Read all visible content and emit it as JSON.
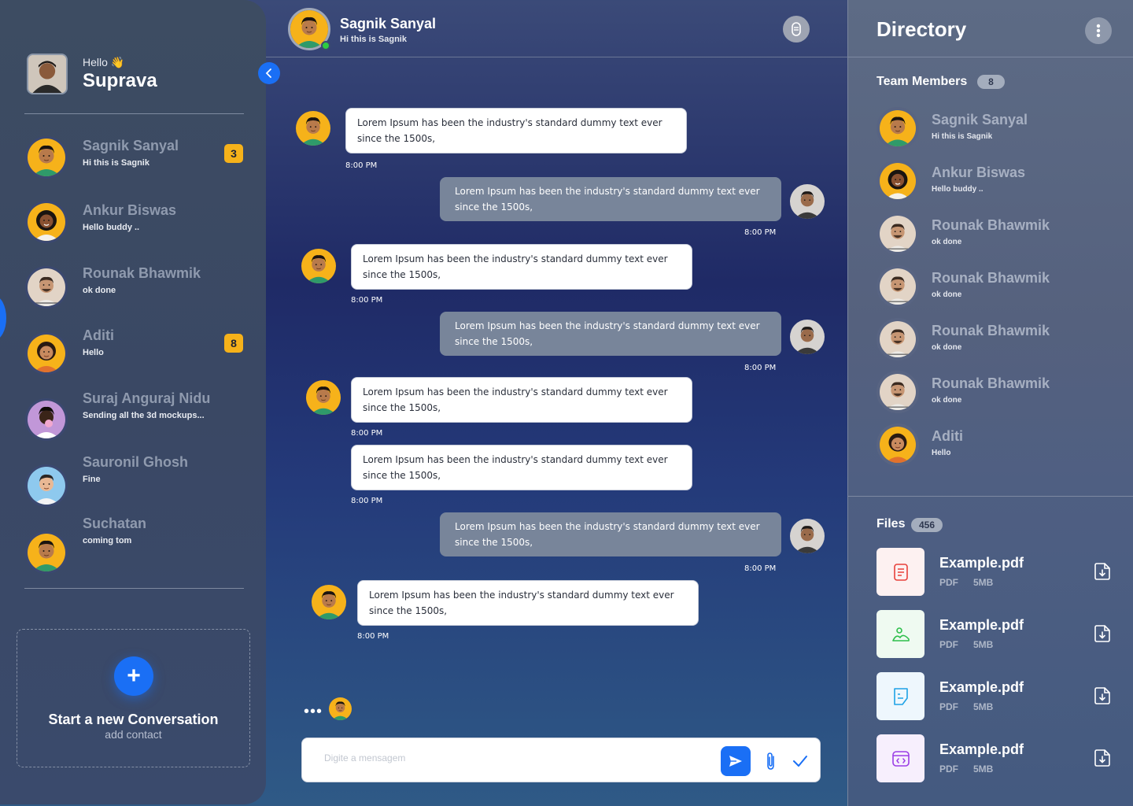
{
  "user": {
    "greeting": "Hello 👋",
    "name": "Suprava"
  },
  "conversations": [
    {
      "name": "Sagnik Sanyal",
      "message": "Hi this is Sagnik",
      "badge": "3",
      "avatar": "yellow-man"
    },
    {
      "name": "Ankur Biswas",
      "message": "Hello buddy ..",
      "badge": null,
      "avatar": "yellow-woman"
    },
    {
      "name": "Rounak Bhawmik",
      "message": "ok done",
      "badge": null,
      "avatar": "beige-man"
    },
    {
      "name": "Aditi",
      "message": "Hello",
      "badge": "8",
      "avatar": "yellow-woman2"
    },
    {
      "name": "Suraj Anguraj Nidu",
      "message": "Sending all the 3d mockups...",
      "badge": null,
      "avatar": "purple-man"
    },
    {
      "name": "Sauronil Ghosh",
      "message": "Fine",
      "badge": null,
      "avatar": "blue-man"
    },
    {
      "name": "Suchatan",
      "message": "coming tom",
      "badge": null,
      "avatar": "yellow-man"
    }
  ],
  "new_conversation": {
    "title": "Start a new Conversation",
    "subtitle": "add contact",
    "button": "+"
  },
  "chat": {
    "contact_name": "Sagnik Sanyal",
    "contact_status": "Hi this is Sagnik",
    "online": true,
    "messages": [
      {
        "direction": "in",
        "text": "Lorem Ipsum has been the industry's standard dummy text ever since the 1500s,",
        "time": "8:00 PM"
      },
      {
        "direction": "out",
        "text": "Lorem Ipsum has been the industry's standard dummy text ever since the 1500s,",
        "time": "8:00 PM"
      },
      {
        "direction": "in",
        "text": "Lorem Ipsum has been the industry's standard dummy text ever since the 1500s,",
        "time": "8:00 PM"
      },
      {
        "direction": "out",
        "text": "Lorem Ipsum has been the industry's standard dummy text ever since the 1500s,",
        "time": "8:00 PM"
      },
      {
        "direction": "in",
        "text": "Lorem Ipsum has been the industry's standard dummy text ever since the 1500s,",
        "time": "8:00 PM"
      },
      {
        "direction": "in",
        "text": "Lorem Ipsum has been the industry's standard dummy text ever since the 1500s,",
        "time": "8:00 PM"
      },
      {
        "direction": "out",
        "text": "Lorem Ipsum has been the industry's standard dummy text ever since the 1500s,",
        "time": "8:00 PM"
      },
      {
        "direction": "in",
        "text": "Lorem Ipsum has been the industry's standard dummy text ever since the 1500s,",
        "time": "8:00 PM"
      }
    ],
    "typing_indicator": "•••",
    "composer_placeholder": "Digite a mensagem"
  },
  "directory": {
    "title": "Directory",
    "team_label": "Team Members",
    "team_count": "8",
    "members": [
      {
        "name": "Sagnik Sanyal",
        "message": "Hi this is Sagnik",
        "avatar": "yellow-man"
      },
      {
        "name": "Ankur Biswas",
        "message": "Hello buddy ..",
        "avatar": "yellow-woman"
      },
      {
        "name": "Rounak Bhawmik",
        "message": "ok done",
        "avatar": "beige-man"
      },
      {
        "name": "Rounak Bhawmik",
        "message": "ok done",
        "avatar": "beige-man"
      },
      {
        "name": "Rounak Bhawmik",
        "message": "ok done",
        "avatar": "beige-man"
      },
      {
        "name": "Rounak Bhawmik",
        "message": "ok done",
        "avatar": "beige-man"
      },
      {
        "name": "Aditi",
        "message": "Hello",
        "avatar": "yellow-woman2"
      }
    ],
    "files_label": "Files",
    "files_count": "456",
    "files": [
      {
        "name": "Example.pdf",
        "type": "PDF",
        "size": "5MB",
        "icon": "document-icon",
        "color": "#e8413b",
        "bg": "#fdf1f1"
      },
      {
        "name": "Example.pdf",
        "type": "PDF",
        "size": "5MB",
        "icon": "image-icon",
        "color": "#2fbf4c",
        "bg": "#effaf1"
      },
      {
        "name": "Example.pdf",
        "type": "PDF",
        "size": "5MB",
        "icon": "note-icon",
        "color": "#1ea2e6",
        "bg": "#eef7fd"
      },
      {
        "name": "Example.pdf",
        "type": "PDF",
        "size": "5MB",
        "icon": "code-icon",
        "color": "#9b3ee6",
        "bg": "#f7effd"
      }
    ]
  },
  "colors": {
    "accent": "#1a6ff5",
    "badge": "#f6b21a",
    "online": "#2ecc40"
  }
}
